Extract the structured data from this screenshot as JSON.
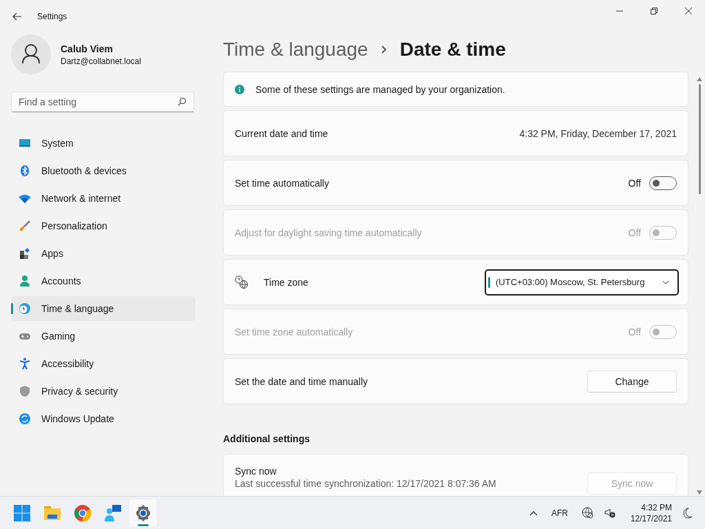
{
  "window": {
    "title": "Settings"
  },
  "profile": {
    "name": "Calub Viem",
    "email": "Dartz@collabnet.local"
  },
  "search": {
    "placeholder": "Find a setting"
  },
  "nav": [
    {
      "label": "System",
      "selected": false
    },
    {
      "label": "Bluetooth & devices",
      "selected": false
    },
    {
      "label": "Network & internet",
      "selected": false
    },
    {
      "label": "Personalization",
      "selected": false
    },
    {
      "label": "Apps",
      "selected": false
    },
    {
      "label": "Accounts",
      "selected": false
    },
    {
      "label": "Time & language",
      "selected": true
    },
    {
      "label": "Gaming",
      "selected": false
    },
    {
      "label": "Accessibility",
      "selected": false
    },
    {
      "label": "Privacy & security",
      "selected": false
    },
    {
      "label": "Windows Update",
      "selected": false
    }
  ],
  "breadcrumb": {
    "parent": "Time & language",
    "current": "Date & time"
  },
  "rows": [
    {
      "kind": "info",
      "label": "Some of these settings are managed by your organization."
    },
    {
      "kind": "value",
      "label": "Current date and time",
      "value": "4:32 PM, Friday, December 17, 2021"
    },
    {
      "kind": "toggle",
      "label": "Set time automatically",
      "state": "Off",
      "on": false,
      "disabled": false
    },
    {
      "kind": "toggle",
      "label": "Adjust for daylight saving time automatically",
      "state": "Off",
      "on": false,
      "disabled": true
    },
    {
      "kind": "dropdown",
      "label": "Time zone",
      "value": "(UTC+03:00) Moscow, St. Petersburg",
      "focused": true
    },
    {
      "kind": "toggle",
      "label": "Set time zone automatically",
      "state": "Off",
      "on": false,
      "disabled": true
    },
    {
      "kind": "button",
      "label": "Set the date and time manually",
      "button": "Change",
      "disabled": false
    }
  ],
  "additional": {
    "heading": "Additional settings",
    "title": "Sync now",
    "detail": "Last successful time synchronization: 12/17/2021 8:07:36 AM",
    "button": "Sync now",
    "disabled": true
  },
  "taskbar": {
    "apps": [
      {
        "selected": false
      },
      {
        "selected": false
      },
      {
        "selected": false
      },
      {
        "selected": false
      },
      {
        "selected": true
      }
    ],
    "language": "AFR",
    "time": "4:32 PM",
    "date": "12/17/2021"
  }
}
